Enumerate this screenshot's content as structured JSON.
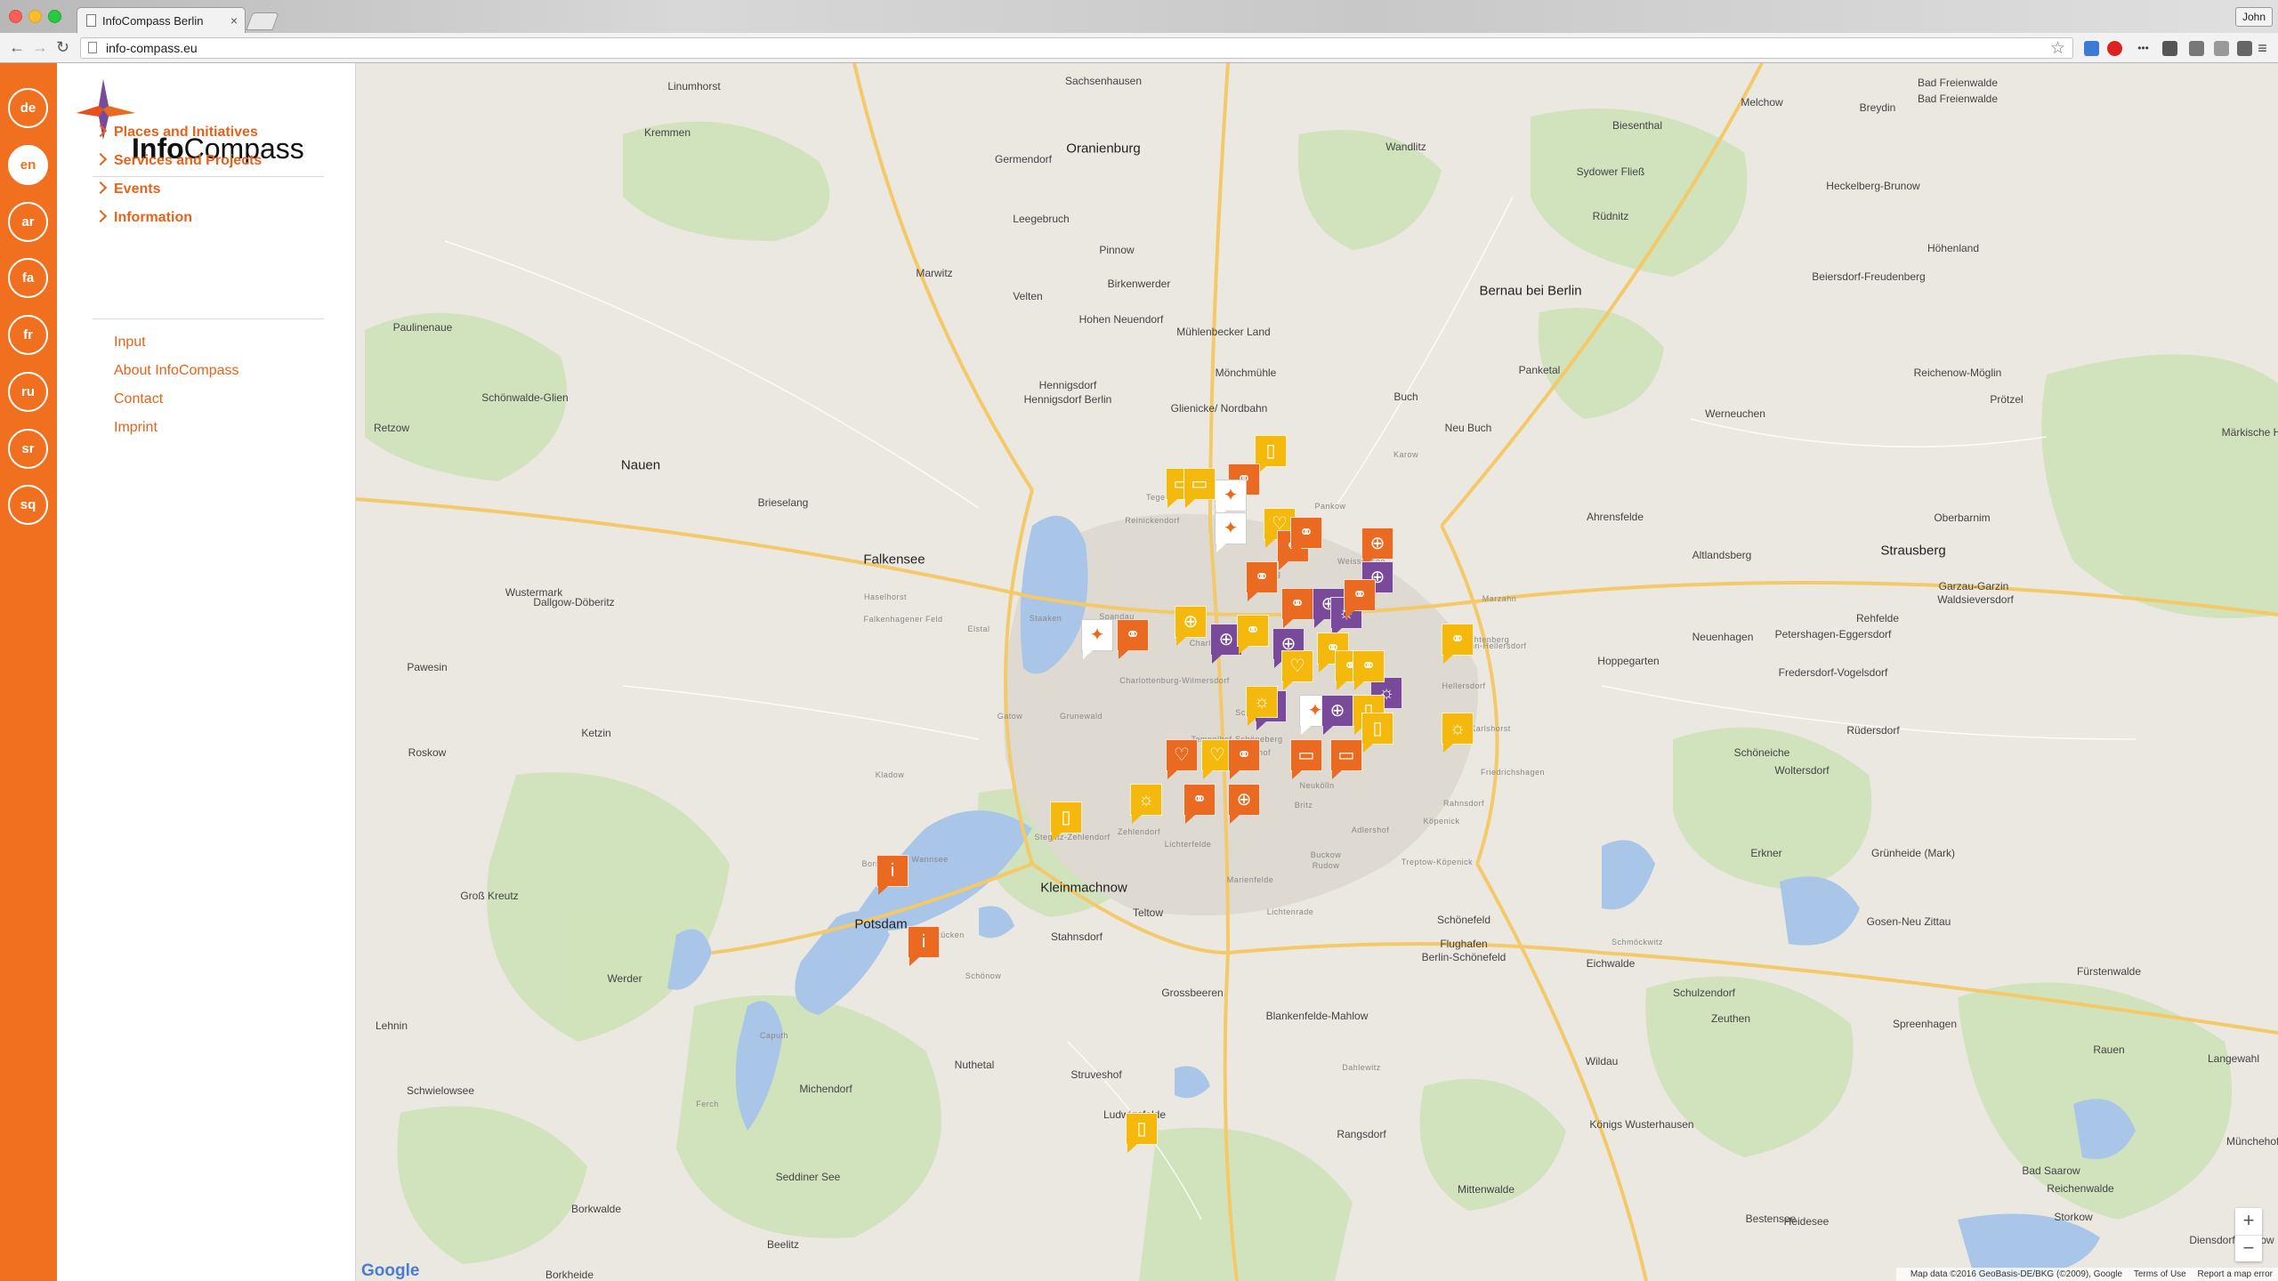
{
  "browser": {
    "tab_title": "InfoCompass Berlin",
    "tab_close": "×",
    "url": "info-compass.eu",
    "user": "John",
    "back": "←",
    "forward": "→",
    "reload": "↻",
    "star": "☆",
    "menu": "≡"
  },
  "languages": [
    "de",
    "en",
    "ar",
    "fa",
    "fr",
    "ru",
    "sr",
    "sq"
  ],
  "active_language": "en",
  "logo": {
    "bold": "Info",
    "rest": "Compass"
  },
  "menu": {
    "main": [
      "Places and Initiatives",
      "Services and Projects",
      "Events",
      "Information"
    ],
    "secondary": [
      "Input",
      "About InfoCompass",
      "Contact",
      "Imprint"
    ]
  },
  "map": {
    "zoom_in": "+",
    "zoom_out": "−",
    "google": "Google",
    "attribution": "Map data ©2016 GeoBasis-DE/BKG (©2009), Google",
    "terms": "Terms of Use",
    "report": "Report a map error",
    "places": [
      "Linumhorst",
      "Kremmen",
      "Oranienburg",
      "Wandlitz",
      "Biesenthal",
      "Melchow",
      "Breydin",
      "Bad Freienwalde",
      "Sachsenhausen",
      "Germendorf",
      "Leegebruch",
      "Sydower Fließ",
      "Heckelberg-Brunow",
      "Rüdnitz",
      "Höhenland",
      "Pinnow",
      "Marwitz",
      "Velten",
      "Birkenwerder",
      "Bernau bei Berlin",
      "Beiersdorf-Freudenberg",
      "Paulinenaue",
      "Hohen Neuendorf",
      "Mühlenbecker Land",
      "Mönchmühle",
      "Panketal",
      "Reichenow-Möglin",
      "Schönwalde-Glien",
      "Hennigsdorf",
      "Hennigsdorf Berlin",
      "Glienicke/ Nordbahn",
      "Buch",
      "Neu Buch",
      "Werneuchen",
      "Prötzel",
      "Retzow",
      "Nauen",
      "Brieselang",
      "Ahrensfelde",
      "Oberbarnim",
      "Falkensee",
      "Altlandsberg",
      "Strausberg",
      "Wustermark",
      "Dallgow-Döberitz",
      "Garzau-Garzin",
      "Waldsieversdorf",
      "Rehfelde",
      "Neuenhagen",
      "Petershagen-Eggersdorf",
      "Hoppegarten",
      "Fredersdorf-Vogelsdorf",
      "Pawesin",
      "Ketzin",
      "Rüdersdorf",
      "Roskow",
      "Schöneiche",
      "Woltersdorf",
      "Erkner",
      "Grünheide (Mark)",
      "Kleinmachnow",
      "Teltow",
      "Potsdam",
      "Stahnsdorf",
      "Groß Kreutz",
      "Werder",
      "Schönefeld",
      "Gosen-Neu Zittau",
      "Eichwalde",
      "Schulzendorf",
      "Zeuthen",
      "Grossbeeren",
      "Blankenfelde-Mahlow",
      "Fürstenwalde",
      "Spreenhagen",
      "Nuthetal",
      "Schwielowsee",
      "Michendorf",
      "Struveshof",
      "Wildau",
      "Königs Wusterhausen",
      "Rauen",
      "Langewahl",
      "Ludwigsfelde",
      "Rangsdorf",
      "Seddiner See",
      "Borkwalde",
      "Mittenwalde",
      "Bad Saarow",
      "Reichenwalde",
      "Beelitz",
      "Bestensee",
      "Heidesee",
      "Storkow",
      "Diensdorf-Radlow",
      "Borkheide",
      "Münchehofe",
      "Märkische Höhe",
      "Berlin-Schönefeld",
      "Flughafen",
      "Lehnin",
      "Bad Freienwalde"
    ],
    "districts": [
      "Tegel",
      "Reinickendorf",
      "Pankow",
      "Weissensee",
      "Wedding",
      "Spandau",
      "Charlottenburg",
      "Charlottenburg-Wilmersdorf",
      "Lichtenberg",
      "Marzahn",
      "Marzahn-Hellersdorf",
      "Hellersdorf",
      "Staaken",
      "Elstal",
      "Gatow",
      "Grunewald",
      "Schöneberg",
      "Tempelhof-Schöneberg",
      "Tempelhof",
      "Neukölln",
      "Britz",
      "Buckow",
      "Rudow",
      "Adlershof",
      "Köpenick",
      "Treptow-Köpenick",
      "Friedrichshagen",
      "Rahnsdorf",
      "Karlshorst",
      "Zehlendorf",
      "Steglitz-Zehlendorf",
      "Lichterfelde",
      "Marienfelde",
      "Lichtenrade",
      "Wannsee",
      "Kladow",
      "Haselhorst",
      "Falkenhagener Feld",
      "Schönow",
      "Bornstedt",
      "Steinstücken",
      "Caputh",
      "Ferch",
      "Dahlewitz",
      "Schmöckwitz",
      "Karow"
    ],
    "markers": [
      {
        "color": "yellow",
        "icon": "speech-icon"
      },
      {
        "color": "yellow",
        "icon": "book-icon"
      },
      {
        "color": "orange",
        "icon": "handshake-icon"
      },
      {
        "color": "white",
        "icon": "compass-icon"
      },
      {
        "color": "yellow",
        "icon": "speech-icon"
      },
      {
        "color": "white",
        "icon": "compass-icon"
      },
      {
        "color": "yellow",
        "icon": "heart-icon"
      },
      {
        "color": "orange",
        "icon": "handshake-icon"
      },
      {
        "color": "orange",
        "icon": "handshake-icon"
      },
      {
        "color": "orange",
        "icon": "globe-icon"
      },
      {
        "color": "purple",
        "icon": "globe-icon"
      },
      {
        "color": "orange",
        "icon": "handshake-icon"
      },
      {
        "color": "orange",
        "icon": "handshake-icon"
      },
      {
        "color": "purple",
        "icon": "globe-icon"
      },
      {
        "color": "purple",
        "icon": "sun-icon"
      },
      {
        "color": "orange",
        "icon": "handshake-icon"
      },
      {
        "color": "yellow",
        "icon": "globe-icon"
      },
      {
        "color": "purple",
        "icon": "globe-icon"
      },
      {
        "color": "yellow",
        "icon": "handshake-icon"
      },
      {
        "color": "white",
        "icon": "compass-icon"
      },
      {
        "color": "orange",
        "icon": "handshake-icon"
      },
      {
        "color": "purple",
        "icon": "globe-icon"
      },
      {
        "color": "yellow",
        "icon": "heart-icon"
      },
      {
        "color": "yellow",
        "icon": "handshake-icon"
      },
      {
        "color": "yellow",
        "icon": "handshake-icon"
      },
      {
        "color": "purple",
        "icon": "sun-icon"
      },
      {
        "color": "yellow",
        "icon": "handshake-icon"
      },
      {
        "color": "purple",
        "icon": "sun-icon"
      },
      {
        "color": "white",
        "icon": "compass-icon"
      },
      {
        "color": "purple",
        "icon": "globe-icon"
      },
      {
        "color": "yellow",
        "icon": "book-icon"
      },
      {
        "color": "yellow",
        "icon": "sun-icon"
      },
      {
        "color": "yellow",
        "icon": "book-icon"
      },
      {
        "color": "orange",
        "icon": "speech-icon"
      },
      {
        "color": "orange",
        "icon": "heart-icon"
      },
      {
        "color": "yellow",
        "icon": "heart-icon"
      },
      {
        "color": "orange",
        "icon": "handshake-icon"
      },
      {
        "color": "orange",
        "icon": "speech-icon"
      },
      {
        "color": "yellow",
        "icon": "sun-icon"
      },
      {
        "color": "orange",
        "icon": "handshake-icon"
      },
      {
        "color": "orange",
        "icon": "globe-icon"
      },
      {
        "color": "yellow",
        "icon": "book-icon"
      },
      {
        "color": "orange",
        "icon": "info-icon"
      },
      {
        "color": "orange",
        "icon": "info-icon"
      },
      {
        "color": "yellow",
        "icon": "book-icon"
      },
      {
        "color": "yellow",
        "icon": "handshake-icon"
      },
      {
        "color": "yellow",
        "icon": "sun-icon"
      }
    ],
    "icon_glyphs": {
      "speech-icon": "▭",
      "book-icon": "▯",
      "handshake-icon": "⚭",
      "compass-icon": "✦",
      "heart-icon": "♡",
      "globe-icon": "⊕",
      "sun-icon": "☼",
      "info-icon": "i"
    },
    "colors": {
      "orange": "#ea6a22",
      "yellow": "#f5b80c",
      "purple": "#7a4a9a",
      "rail": "#f07020"
    }
  }
}
